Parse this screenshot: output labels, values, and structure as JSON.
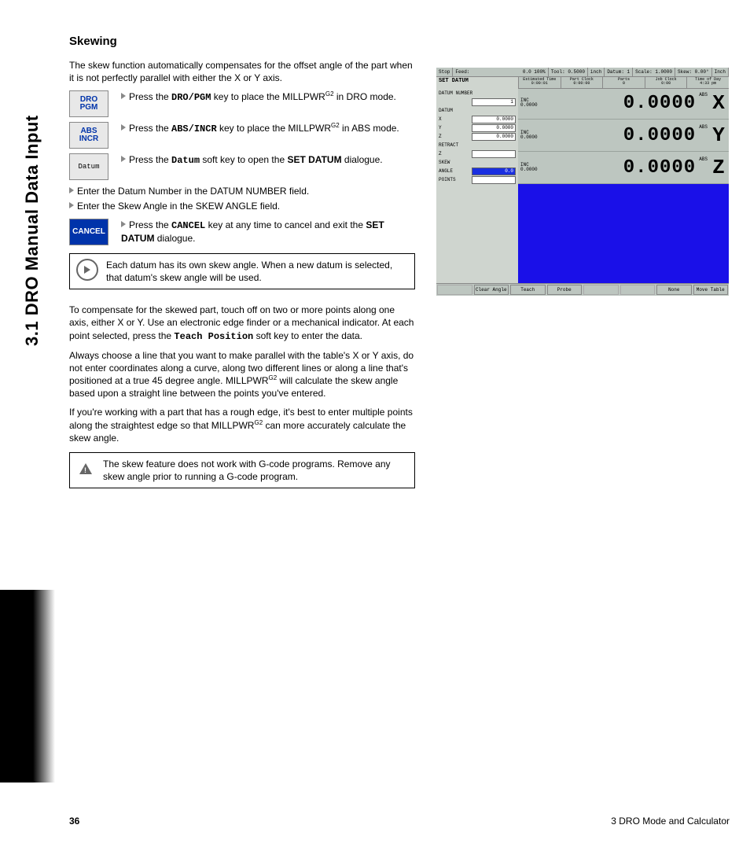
{
  "side_tab": "3.1 DRO Manual Data Input",
  "heading": "Skewing",
  "intro": "The skew function automatically compensates for the offset angle of the part when it is not perfectly parallel with either the X or Y axis.",
  "keys": {
    "dro_pgm_l1": "DRO",
    "dro_pgm_l2": "PGM",
    "abs_incr_l1": "ABS",
    "abs_incr_l2": "INCR",
    "datum": "Datum",
    "cancel": "CANCEL"
  },
  "steps": {
    "s1a": "Press the ",
    "s1k": "DRO/PGM",
    "s1b": " key to place the MILLPWR",
    "s1sup": "G2",
    "s1c": " in DRO mode.",
    "s2a": "Press the ",
    "s2k": "ABS/INCR",
    "s2b": " key to place the MILLPWR",
    "s2sup": "G2",
    "s2c": " in ABS mode.",
    "s3a": "Press the ",
    "s3k": "Datum",
    "s3b": " soft key to open the ",
    "s3strong": "SET DATUM",
    "s3c": " dialogue.",
    "s4": "Enter the Datum Number in the DATUM NUMBER field.",
    "s5": "Enter the Skew Angle in the SKEW ANGLE field.",
    "s6a": "Press the ",
    "s6k": "CANCEL",
    "s6b": " key at any time to cancel and exit the ",
    "s6strong": "SET DATUM",
    "s6c": " dialogue."
  },
  "note1": "Each datum has its own skew angle. When a new datum is selected, that datum's skew angle will be used.",
  "p2a": "To compensate for the skewed part, touch off on two or more points along one axis, either X or Y. Use an electronic edge finder or a mechanical indicator. At each point selected, press the ",
  "p2k": "Teach Position",
  "p2b": " soft key to enter the data.",
  "p3a": "Always choose a line that you want to make parallel with the table's X or Y axis, do not enter coordinates along a curve, along two different lines or along a line that's positioned at a true 45 degree angle. MILLPWR",
  "p3sup": "G2",
  "p3b": " will calculate the skew angle based upon a straight line between the points you've entered.",
  "p4a": "If you're working with a part that has a rough edge, it's best to enter multiple points along the straightest edge so that MILLPWR",
  "p4sup": "G2",
  "p4b": " can more accurately calculate the skew angle.",
  "note2": "The skew feature does not work with G-code programs. Remove any skew angle prior to running a G-code program.",
  "footer_page": "36",
  "footer_chapter": "3 DRO Mode and Calculator",
  "shot": {
    "top": {
      "stop": "Stop",
      "feed": "Feed:",
      "feedv": "0.0 100%",
      "tool": "Tool:",
      "toolv": "0.5000",
      "unit": "inch",
      "datum": "Datum: 1",
      "scale": "Scale: 1.0000",
      "skew": "Skew:",
      "skewv": "0.00°",
      "inch": "Inch"
    },
    "time": {
      "set_datum": "SET DATUM",
      "est_l": "Estimated Time",
      "est_v": "0:00:01",
      "part_l": "Part Clock",
      "part_v": "0:00:00",
      "parts_l": "Parts",
      "parts_v": "0",
      "job_l": "Job Clock",
      "job_v": "0:00",
      "tod_l": "Time of Day",
      "tod_v": "4:33 pm"
    },
    "left": {
      "datum_number_l": "DATUM NUMBER",
      "datum_number_v": "1",
      "datum_l": "DATUM",
      "x_l": "X",
      "x_v": "0.0000",
      "y_l": "Y",
      "y_v": "0.0000",
      "z_l": "Z",
      "z_v": "0.0000",
      "retract_l": "RETRACT",
      "rz_l": "Z",
      "rz_v": "",
      "skew_l": "SKEW",
      "angle_l": "ANGLE",
      "angle_v": "0.0",
      "points_l": "POINTS",
      "points_v": ""
    },
    "dro": {
      "inc": "INC",
      "incv": "0.0000",
      "big": "0.0000",
      "abs": "ABS",
      "X": "X",
      "Y": "Y",
      "Z": "Z"
    },
    "soft": {
      "k1": "",
      "k2": "Clear Angle",
      "k3": "Teach",
      "k4": "Probe",
      "k5": "",
      "k6": "",
      "k7": "None",
      "k8": "Move Table"
    }
  }
}
